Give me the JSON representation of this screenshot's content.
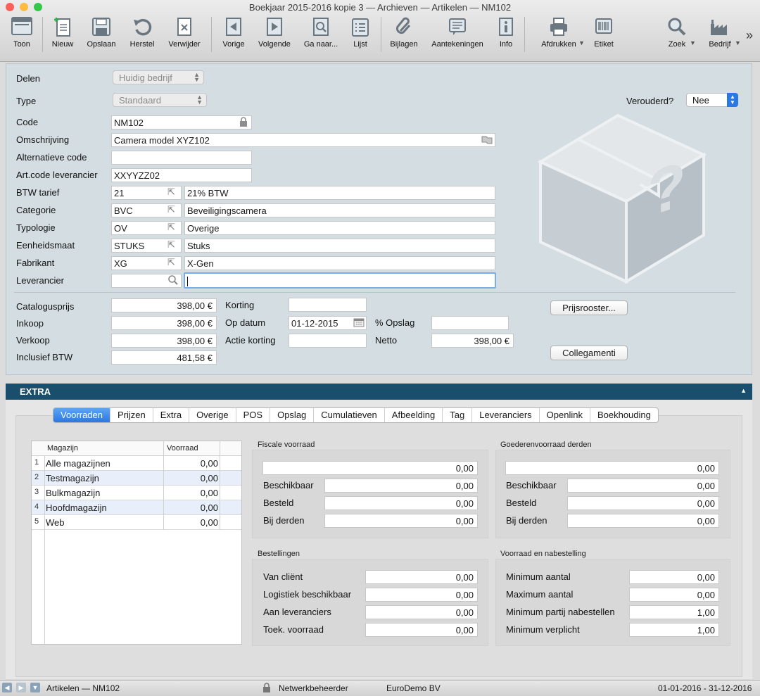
{
  "window": {
    "title": "Boekjaar 2015-2016 kopie 3 — Archieven — Artikelen — NM102"
  },
  "toolbar": {
    "toon": "Toon",
    "nieuw": "Nieuw",
    "opslaan": "Opslaan",
    "herstel": "Herstel",
    "verwijder": "Verwijder",
    "vorige": "Vorige",
    "volgende": "Volgende",
    "ganaar": "Ga naar...",
    "lijst": "Lijst",
    "bijlagen": "Bijlagen",
    "aantekeningen": "Aantekeningen",
    "info": "Info",
    "afdrukken": "Afdrukken",
    "etiket": "Etiket",
    "zoek": "Zoek",
    "bedrijf": "Bedrijf",
    "more": "»"
  },
  "form": {
    "delen": {
      "label": "Delen",
      "value": "Huidig bedrijf"
    },
    "type": {
      "label": "Type",
      "value": "Standaard"
    },
    "verouderd": {
      "label": "Verouderd?",
      "value": "Nee"
    },
    "code": {
      "label": "Code",
      "value": "NM102"
    },
    "omschrijving": {
      "label": "Omschrijving",
      "value": "Camera model XYZ102"
    },
    "altcode": {
      "label": "Alternatieve code",
      "value": ""
    },
    "artcode": {
      "label": "Art.code leverancier",
      "value": "XXYYZZ02"
    },
    "btw": {
      "label": "BTW tarief",
      "code": "21",
      "desc": "21% BTW"
    },
    "categorie": {
      "label": "Categorie",
      "code": "BVC",
      "desc": "Beveiligingscamera"
    },
    "typologie": {
      "label": "Typologie",
      "code": "OV",
      "desc": "Overige"
    },
    "eenheid": {
      "label": "Eenheidsmaat",
      "code": "STUKS",
      "desc": "Stuks"
    },
    "fabrikant": {
      "label": "Fabrikant",
      "code": "XG",
      "desc": "X-Gen"
    },
    "leverancier": {
      "label": "Leverancier",
      "code": "",
      "desc": ""
    }
  },
  "prices": {
    "catalogus": {
      "label": "Catalogusprijs",
      "value": "398,00 €"
    },
    "inkoop": {
      "label": "Inkoop",
      "value": "398,00 €"
    },
    "verkoop": {
      "label": "Verkoop",
      "value": "398,00 €"
    },
    "incl": {
      "label": "Inclusief BTW",
      "value": "481,58 €"
    },
    "korting": {
      "label": "Korting",
      "value": ""
    },
    "opdatum": {
      "label": "Op datum",
      "value": "01-12-2015"
    },
    "actie": {
      "label": "Actie korting",
      "value": ""
    },
    "opslag": {
      "label": "% Opslag",
      "value": ""
    },
    "netto": {
      "label": "Netto",
      "value": "398,00 €"
    },
    "prijsrooster": "Prijsrooster...",
    "collegamenti": "Collegamenti"
  },
  "extra": {
    "title": "EXTRA",
    "tabs": [
      "Voorraden",
      "Prijzen",
      "Extra",
      "Overige",
      "POS",
      "Opslag",
      "Cumulatieven",
      "Afbeelding",
      "Tag",
      "Leveranciers",
      "Openlink",
      "Boekhouding"
    ]
  },
  "magazijn": {
    "col1": "Magazijn",
    "col2": "Voorraad",
    "rows": [
      {
        "n": "1",
        "name": "Alle magazijnen",
        "qty": "0,00"
      },
      {
        "n": "2",
        "name": "Testmagazijn",
        "qty": "0,00"
      },
      {
        "n": "3",
        "name": "Bulkmagazijn",
        "qty": "0,00"
      },
      {
        "n": "4",
        "name": "Hoofdmagazijn",
        "qty": "0,00"
      },
      {
        "n": "5",
        "name": "Web",
        "qty": "0,00"
      }
    ]
  },
  "fiscale": {
    "title": "Fiscale voorraad",
    "total": "0,00",
    "beschikbaar": {
      "label": "Beschikbaar",
      "value": "0,00"
    },
    "besteld": {
      "label": "Besteld",
      "value": "0,00"
    },
    "bijderden": {
      "label": "Bij derden",
      "value": "0,00"
    }
  },
  "goederen": {
    "title": "Goederenvoorraad derden",
    "total": "0,00",
    "beschikbaar": {
      "label": "Beschikbaar",
      "value": "0,00"
    },
    "besteld": {
      "label": "Besteld",
      "value": "0,00"
    },
    "bijderden": {
      "label": "Bij derden",
      "value": "0,00"
    }
  },
  "bestellingen": {
    "title": "Bestellingen",
    "vanclient": {
      "label": "Van cliënt",
      "value": "0,00"
    },
    "logistiek": {
      "label": "Logistiek beschikbaar",
      "value": "0,00"
    },
    "aanlev": {
      "label": "Aan leveranciers",
      "value": "0,00"
    },
    "toek": {
      "label": "Toek. voorraad",
      "value": "0,00"
    }
  },
  "nabestelling": {
    "title": "Voorraad en nabestelling",
    "min": {
      "label": "Minimum aantal",
      "value": "0,00"
    },
    "max": {
      "label": "Maximum aantal",
      "value": "0,00"
    },
    "minpartij": {
      "label": "Minimum partij nabestellen",
      "value": "1,00"
    },
    "minverplicht": {
      "label": "Minimum verplicht",
      "value": "1,00"
    }
  },
  "status": {
    "record": "Artikelen — NM102",
    "user": "Netwerkbeheerder",
    "company": "EuroDemo BV",
    "period": "01-01-2016 - 31-12-2016"
  },
  "colors": {
    "accent": "#2a78e3",
    "sectionHeader": "#194f6c",
    "formBg": "#d4dde2"
  }
}
